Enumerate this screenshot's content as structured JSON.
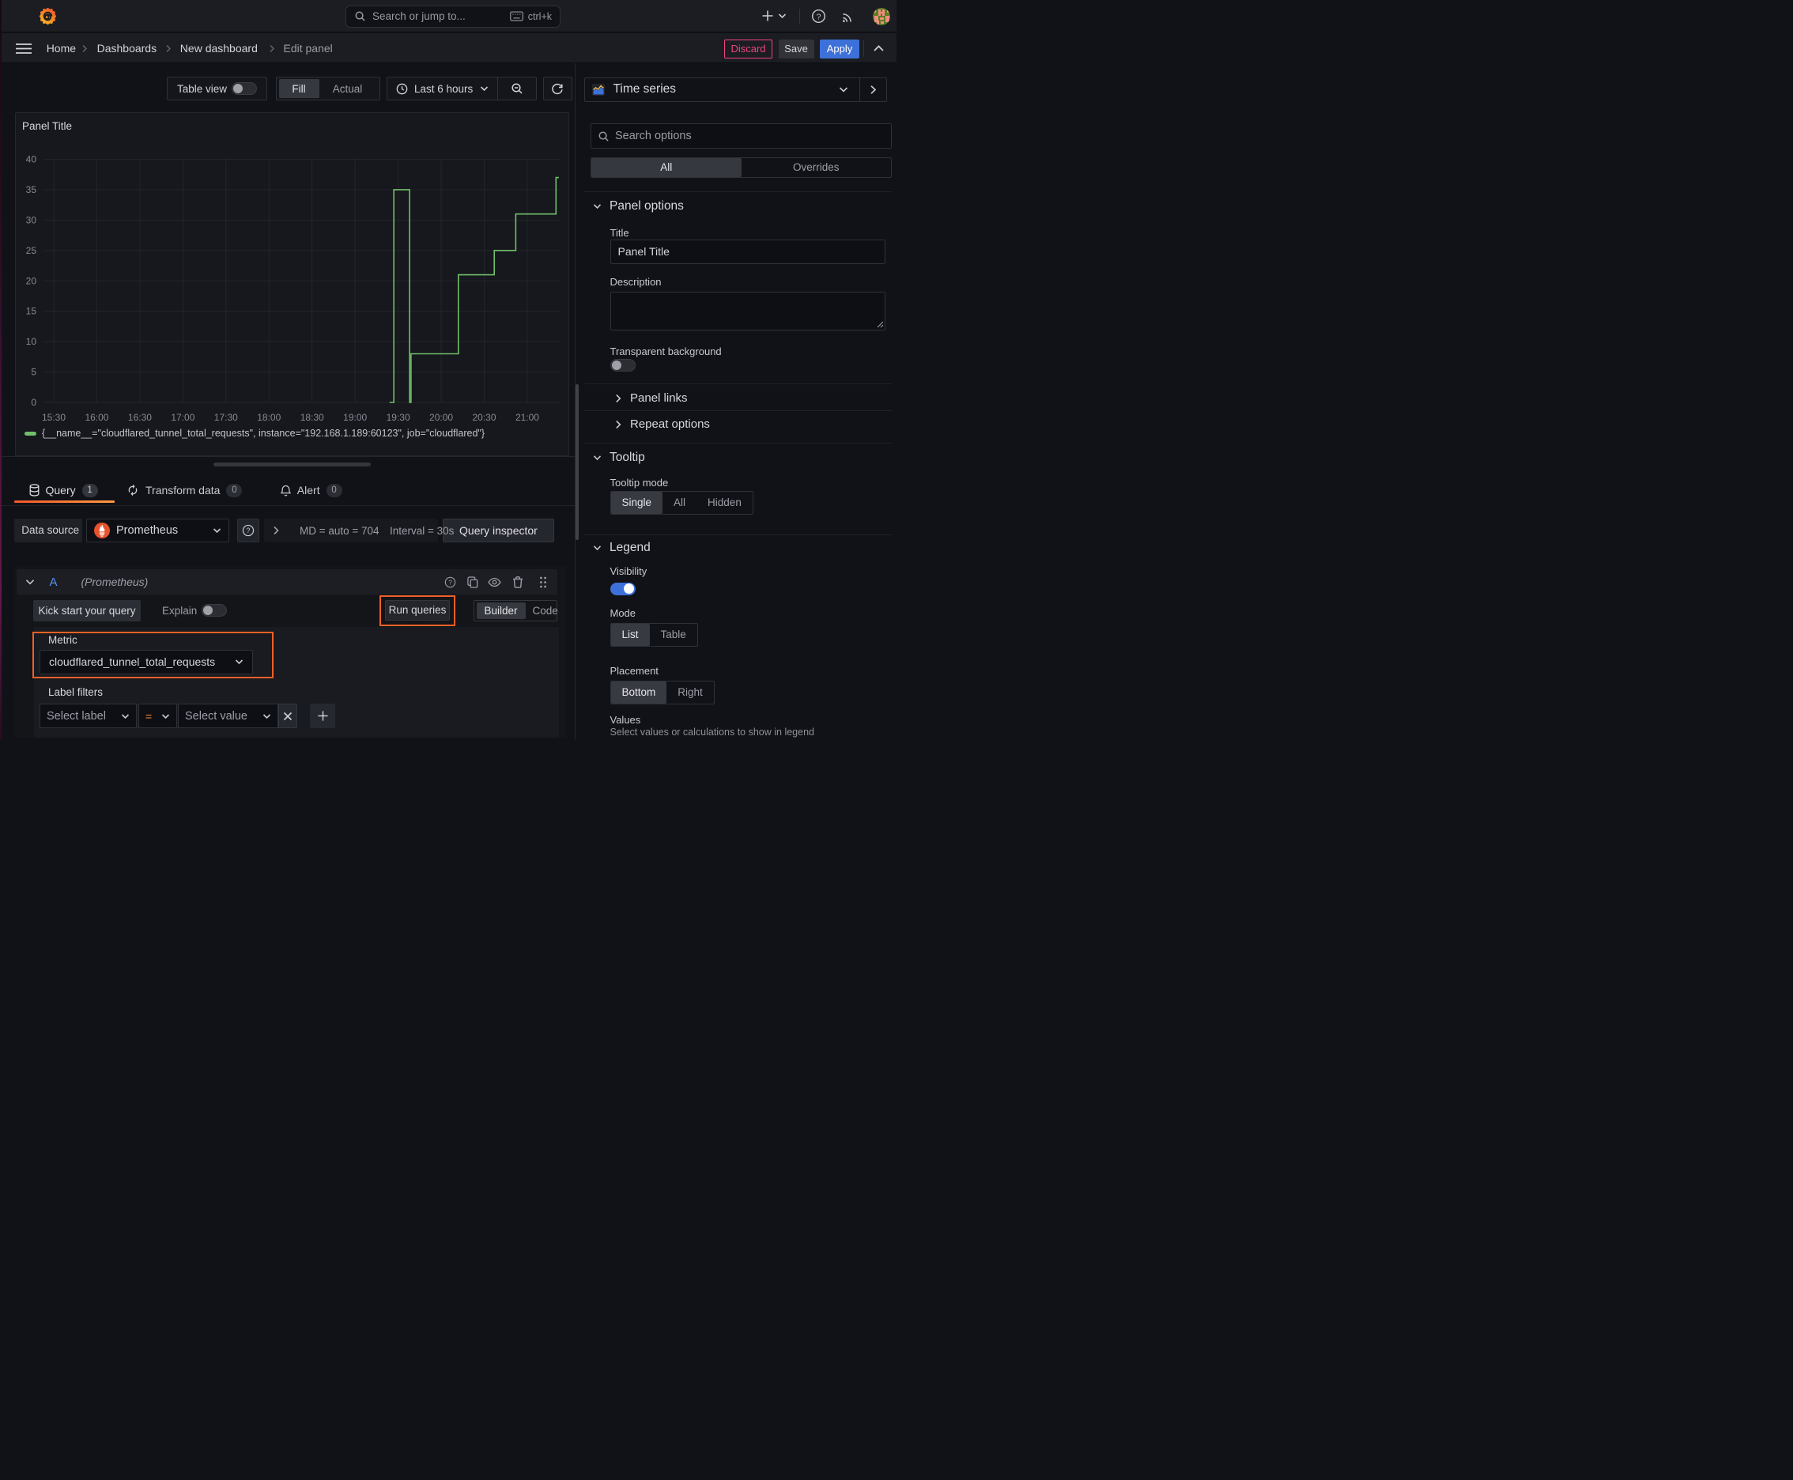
{
  "topnav": {
    "logo_icon": "grafana-logo",
    "search_placeholder": "Search or jump to...",
    "search_shortcut": "ctrl+k"
  },
  "breadcrumb": {
    "items": [
      {
        "label": "Home"
      },
      {
        "label": "Dashboards"
      },
      {
        "label": "New dashboard"
      },
      {
        "label": "Edit panel"
      }
    ],
    "discard_label": "Discard",
    "save_label": "Save",
    "apply_label": "Apply"
  },
  "toolbar": {
    "table_view_label": "Table view",
    "fill_label": "Fill",
    "actual_label": "Actual",
    "time_range_label": "Last 6 hours"
  },
  "chart_data": {
    "type": "line",
    "line_interpolation": "step-after",
    "title": "Panel Title",
    "series": [
      {
        "name": "{__name__=\"cloudflared_tunnel_total_requests\", instance=\"192.168.1.189:60123\", job=\"cloudflared\"}",
        "color": "#73bf69",
        "points": [
          [
            "19:24",
            0
          ],
          [
            "19:27",
            35
          ],
          [
            "19:38",
            0
          ],
          [
            "19:39",
            8
          ],
          [
            "20:12",
            21
          ],
          [
            "20:37",
            25
          ],
          [
            "20:52",
            31
          ],
          [
            "21:20",
            37
          ],
          [
            "21:22",
            37
          ]
        ]
      }
    ],
    "x_ticks": [
      "15:30",
      "16:00",
      "16:30",
      "17:00",
      "17:30",
      "18:00",
      "18:30",
      "19:00",
      "19:30",
      "20:00",
      "20:30",
      "21:00"
    ],
    "x_domain": [
      "15:22.5",
      "21:22.5"
    ],
    "y_ticks": [
      0,
      5,
      10,
      15,
      20,
      25,
      30,
      35,
      40
    ],
    "ylim": [
      0,
      40
    ],
    "grid": true,
    "legend_position": "bottom"
  },
  "query_section": {
    "tabs": [
      {
        "label": "Query",
        "badge": "1",
        "icon": "database-icon"
      },
      {
        "label": "Transform data",
        "badge": "0",
        "icon": "transform-icon"
      },
      {
        "label": "Alert",
        "badge": "0",
        "icon": "bell-icon"
      }
    ],
    "datasource": {
      "label": "Data source",
      "value": "Prometheus",
      "md_text": "MD = auto = 704",
      "interval_text": "Interval = 30s",
      "inspector_label": "Query inspector"
    },
    "query_row": {
      "ref_id": "A",
      "datasource_hint": "(Prometheus)"
    },
    "actions": {
      "kick_start_label": "Kick start your query",
      "explain_label": "Explain",
      "run_queries_label": "Run queries",
      "builder_label": "Builder",
      "code_label": "Code"
    },
    "metric": {
      "label": "Metric",
      "value": "cloudflared_tunnel_total_requests"
    },
    "label_filters": {
      "label": "Label filters",
      "select_label_placeholder": "Select label",
      "operator": "=",
      "select_value_placeholder": "Select value"
    }
  },
  "options_pane": {
    "visualization_label": "Time series",
    "search_placeholder": "Search options",
    "filter_all_label": "All",
    "filter_overrides_label": "Overrides",
    "panel_options": {
      "title": "Panel options",
      "title_label": "Title",
      "title_value": "Panel Title",
      "description_label": "Description",
      "description_value": "",
      "transparent_label": "Transparent background",
      "panel_links_label": "Panel links",
      "repeat_options_label": "Repeat options"
    },
    "tooltip": {
      "title": "Tooltip",
      "mode_label": "Tooltip mode",
      "mode_options": [
        "Single",
        "All",
        "Hidden"
      ],
      "mode_selected": "Single"
    },
    "legend": {
      "title": "Legend",
      "visibility_label": "Visibility",
      "visibility_on": true,
      "mode_label": "Mode",
      "mode_options": [
        "List",
        "Table"
      ],
      "mode_selected": "List",
      "placement_label": "Placement",
      "placement_options": [
        "Bottom",
        "Right"
      ],
      "placement_selected": "Bottom",
      "values_label": "Values",
      "values_hint": "Select values or calculations to show in legend"
    }
  },
  "colors": {
    "accent_blue": "#3d71d9",
    "accent_orange": "#ff8833",
    "annotation_orange": "#ee6127",
    "series_green": "#73bf69",
    "discard_pink": "#f1447e"
  }
}
